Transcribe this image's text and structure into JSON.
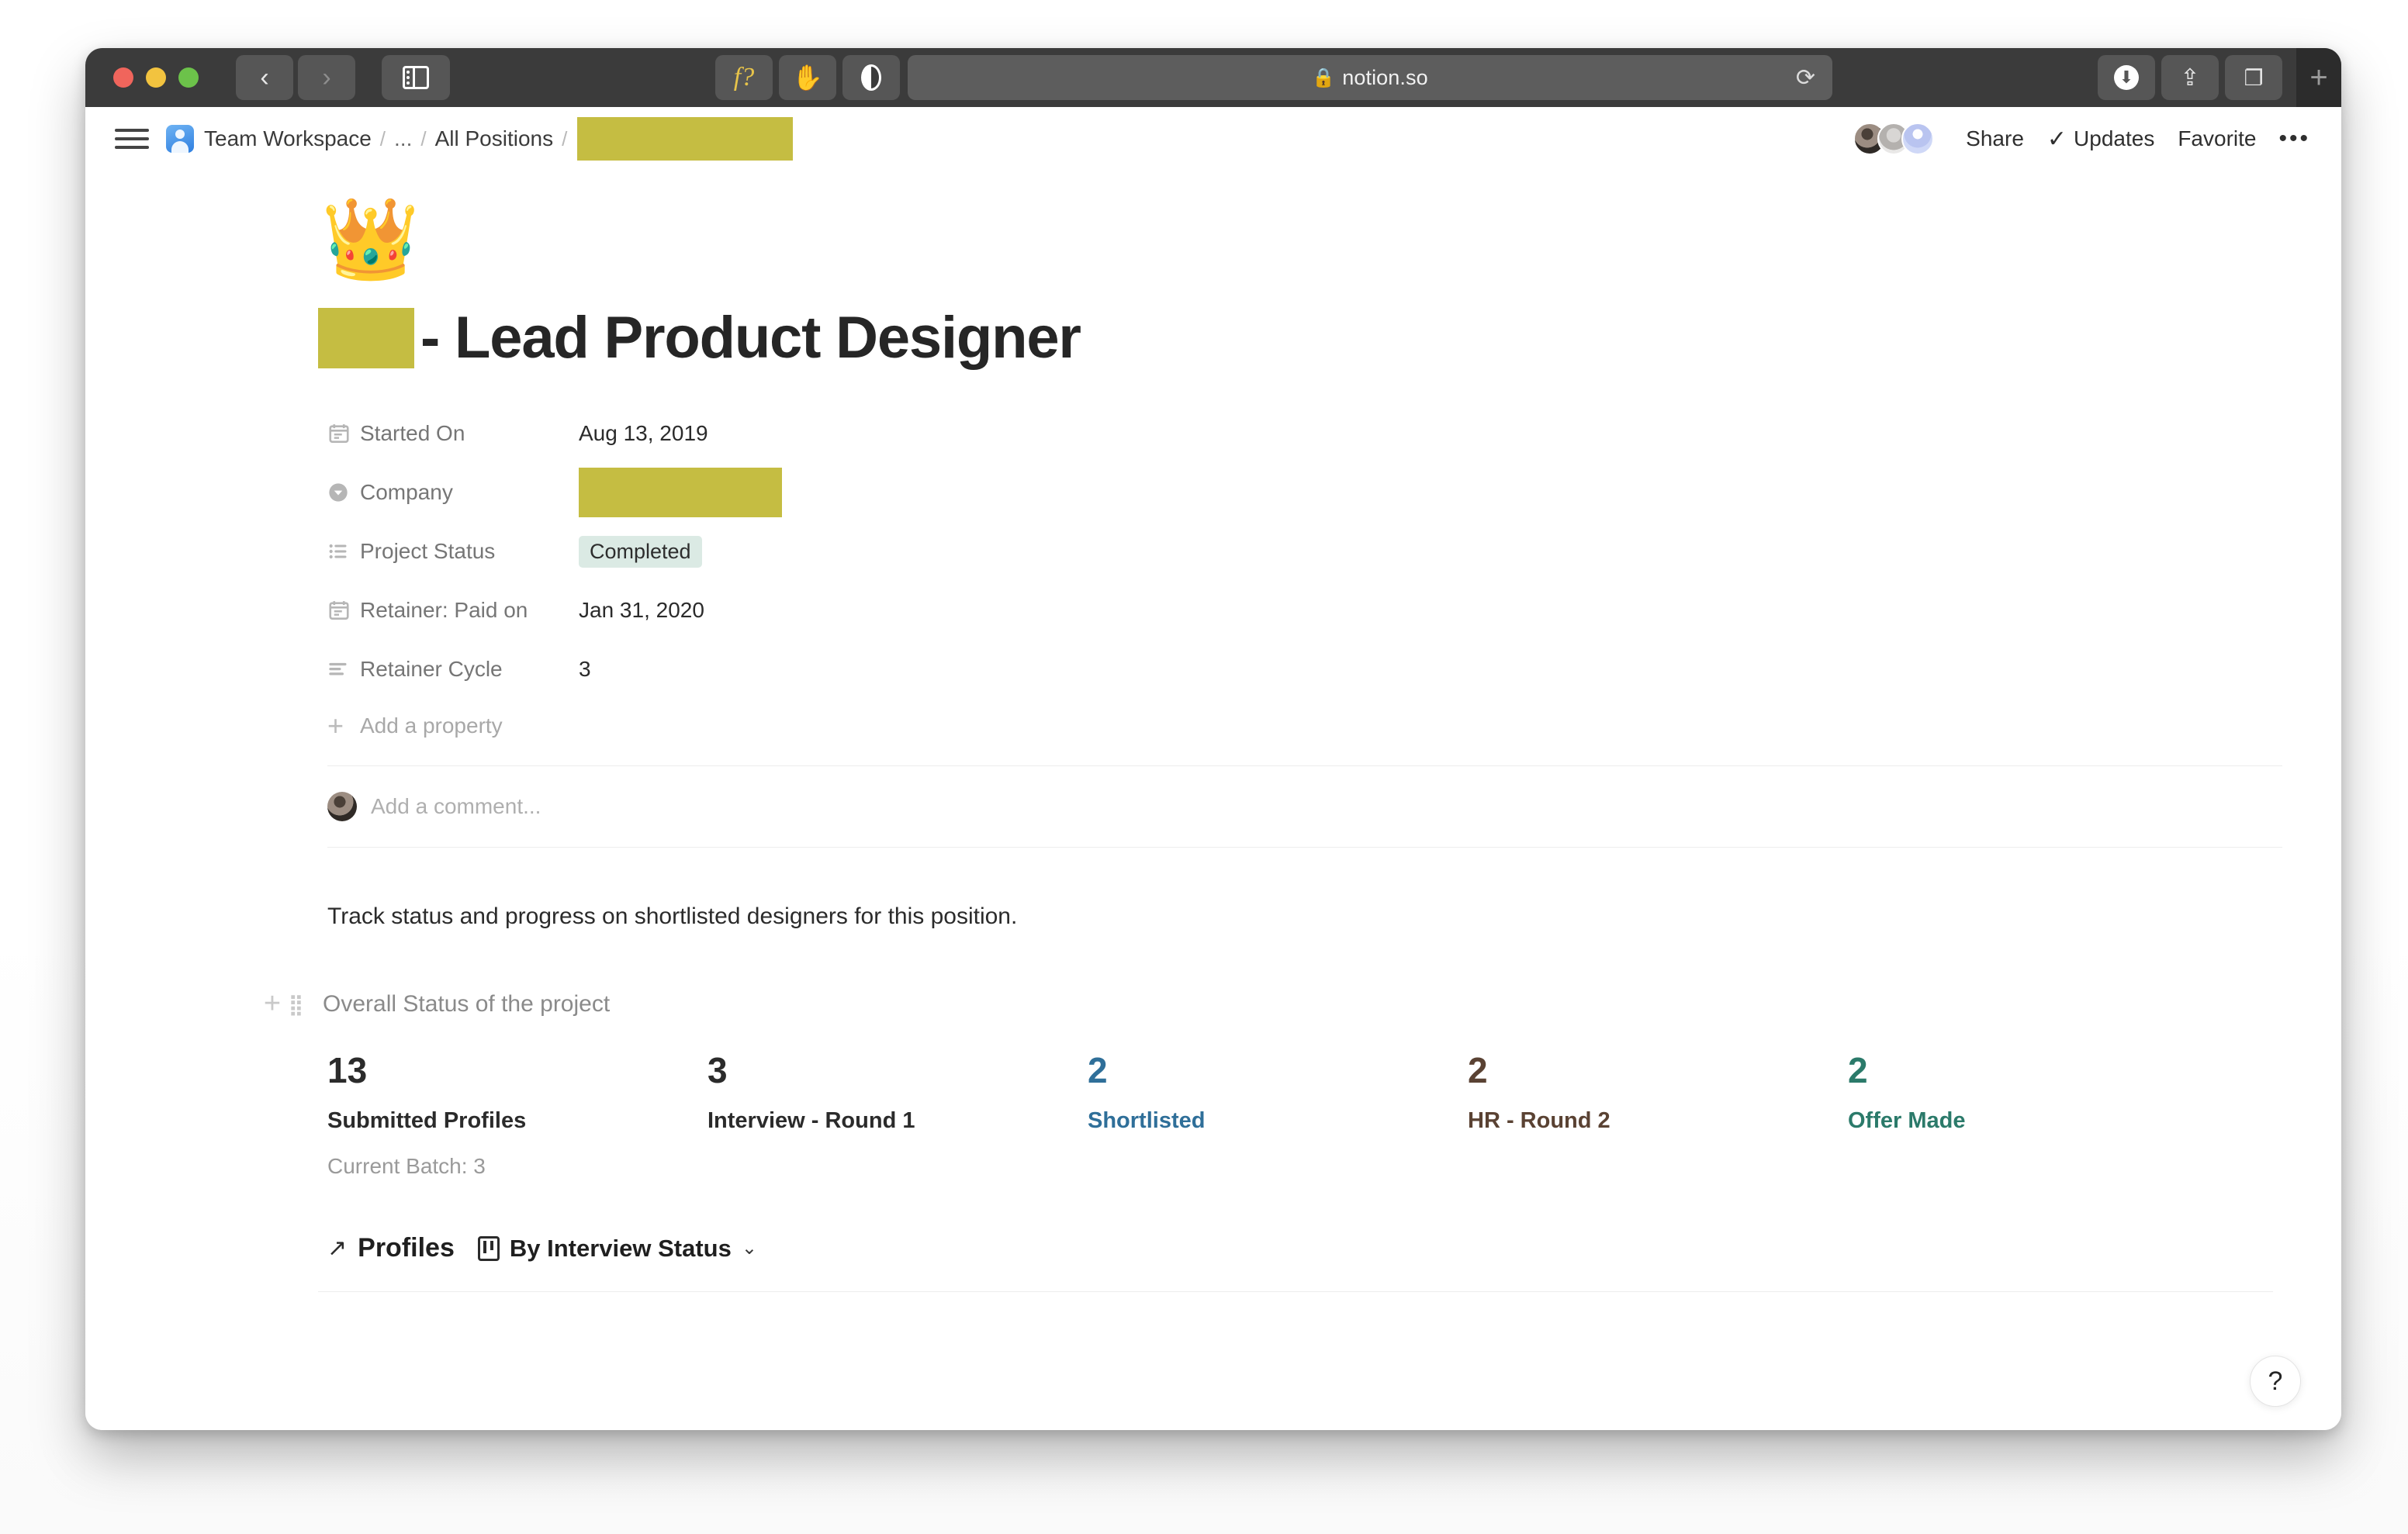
{
  "browser": {
    "url": "notion.so",
    "lock_icon": "lock-icon",
    "back_icon": "chevron-left-icon",
    "forward_icon": "chevron-right-icon",
    "sidebar_icon": "sidebar-toggle-icon",
    "reload_icon": "reload-icon",
    "extension_1": "f?",
    "extension_2": "hand-icon",
    "extension_3": "contrast-icon",
    "download_icon": "download-icon",
    "share_icon": "share-icon",
    "tabs_icon": "tab-overview-icon",
    "newtab_label": "+"
  },
  "header": {
    "menu_icon": "hamburger-menu-icon",
    "workspace_icon": "team-workspace-icon",
    "breadcrumb": [
      {
        "label": "Team Workspace",
        "type": "text"
      },
      {
        "label": "...",
        "type": "text"
      },
      {
        "label": "All Positions",
        "type": "text"
      },
      {
        "label": "",
        "type": "redacted"
      }
    ],
    "separator": "/",
    "share_label": "Share",
    "updates_label": "Updates",
    "updates_icon": "check-icon",
    "favorite_label": "Favorite",
    "more_label": "•••"
  },
  "page": {
    "emoji": "👑",
    "title_redacted": true,
    "title": "- Lead Product Designer"
  },
  "properties": [
    {
      "icon": "calendar-icon",
      "name": "Started On",
      "value": "Aug 13, 2019",
      "kind": "text"
    },
    {
      "icon": "select-icon",
      "name": "Company",
      "value": "",
      "kind": "redacted"
    },
    {
      "icon": "multi-select-icon",
      "name": "Project Status",
      "value": "Completed",
      "kind": "badge"
    },
    {
      "icon": "calendar-icon",
      "name": "Retainer: Paid on",
      "value": "Jan 31, 2020",
      "kind": "text"
    },
    {
      "icon": "text-icon",
      "name": "Retainer Cycle",
      "value": "3",
      "kind": "text"
    }
  ],
  "add_property_label": "Add a property",
  "comment": {
    "placeholder": "Add a comment...",
    "avatar": "user-avatar"
  },
  "intro_text": "Track status and progress on shortlisted designers for this position.",
  "overall": {
    "plus_icon": "add-block-icon",
    "grip_icon": "drag-handle-icon",
    "label": "Overall Status of the project"
  },
  "stats": [
    {
      "number": "13",
      "label": "Submitted Profiles",
      "color": "#2b2b2b"
    },
    {
      "number": "3",
      "label": "Interview - Round 1",
      "color": "#2b2b2b"
    },
    {
      "number": "2",
      "label": "Shortlisted",
      "color": "#2f6f99"
    },
    {
      "number": "2",
      "label": "HR - Round 2",
      "color": "#5a4233"
    },
    {
      "number": "2",
      "label": "Offer Made",
      "color": "#2b7a6a"
    }
  ],
  "current_batch_note": "Current Batch: 3",
  "profiles": {
    "link_icon": "external-link-arrow-icon",
    "title": "Profiles",
    "view_icon": "board-view-icon",
    "view_name": "By Interview Status",
    "caret_icon": "chevron-down-icon"
  },
  "help_button_label": "?",
  "colors": {
    "redaction": "#c5bd42",
    "badge_bg": "#dbeae4",
    "toolbar_bg": "#3b3b3b"
  }
}
